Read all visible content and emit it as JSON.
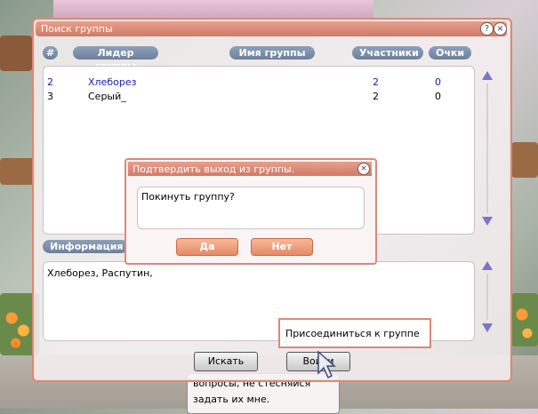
{
  "window": {
    "title": "Поиск группы",
    "help_label": "?",
    "close_label": "×"
  },
  "columns": {
    "num": "#",
    "leader": "Лидер группы",
    "name": "Имя группы",
    "members": "Участники",
    "points": "Очки"
  },
  "rows": [
    {
      "num": "2",
      "leader": "Хлеборез",
      "name": "",
      "members": "2",
      "points": "0",
      "color": "#1a1ab0"
    },
    {
      "num": "3",
      "leader": "Серый_",
      "name": "",
      "members": "2",
      "points": "0",
      "color": "#000000"
    }
  ],
  "info": {
    "label": "Информация",
    "text": "Хлеборез, Распутин,"
  },
  "buttons": {
    "search": "Искать",
    "join": "Войти"
  },
  "dialog": {
    "title": "Подтвердить выход из группы.",
    "close_label": "×",
    "message": "Покинуть группу?",
    "yes": "Да",
    "no": "Нет"
  },
  "tooltip": {
    "text": "Присоединиться к группе"
  },
  "bubble": {
    "line1": "вопросы, не стесняйся",
    "line2": "задать их мне."
  },
  "colors": {
    "frame": "#d98a78",
    "titlebar": "#cf7a66",
    "pill": "#7d8fa8",
    "scroll_arrow": "#7a76c8",
    "button_orange": "#e48a66"
  }
}
